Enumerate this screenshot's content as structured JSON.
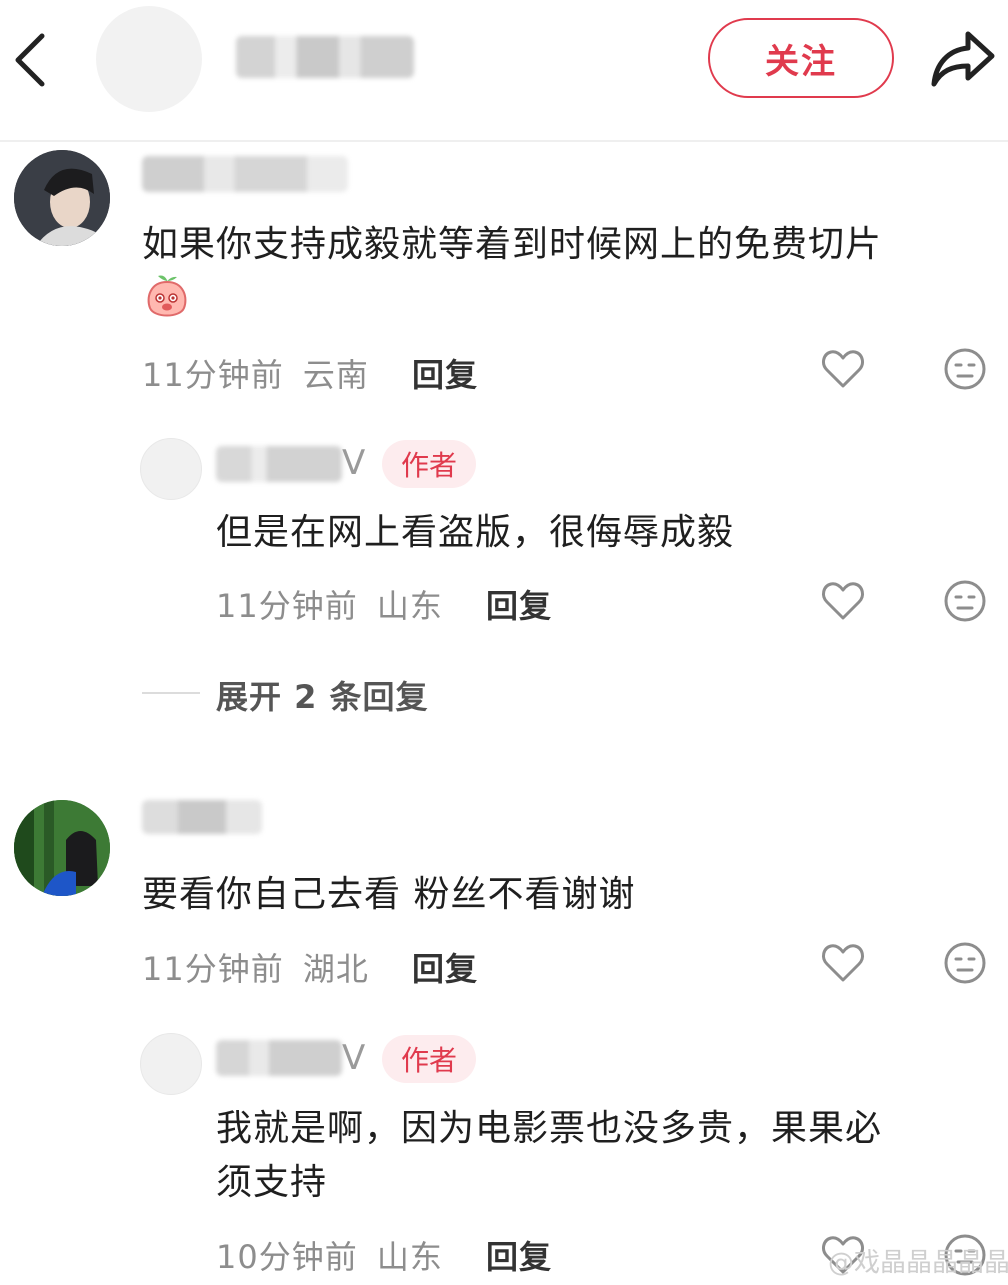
{
  "header": {
    "follow_label": "关注",
    "back_icon": "chevron-left-icon",
    "share_icon": "share-arrow-icon"
  },
  "comments": [
    {
      "content": "如果你支持成毅就等着到时候网上的免费切片",
      "emoji": "peach-emoji",
      "time": "11分钟前",
      "location": "云南",
      "reply_label": "回复",
      "replies": [
        {
          "v_mark": "V",
          "badge": "作者",
          "content": "但是在网上看盗版，很侮辱成毅",
          "time": "11分钟前",
          "location": "山东",
          "reply_label": "回复"
        }
      ],
      "expand_label": "展开 2 条回复"
    },
    {
      "content": "要看你自己去看 粉丝不看谢谢",
      "time": "11分钟前",
      "location": "湖北",
      "reply_label": "回复",
      "replies": [
        {
          "v_mark": "V",
          "badge": "作者",
          "content_line1": "我就是啊，因为电影票也没多贵，果果必",
          "content_line2": "须支持",
          "time": "10分钟前",
          "location": "山东",
          "reply_label": "回复"
        }
      ]
    }
  ],
  "watermark": "@戏晶晶晶晶晶",
  "colors": {
    "accent": "#e03a4d",
    "badge_bg": "#fdecee",
    "meta_text": "#8d8d8d"
  }
}
